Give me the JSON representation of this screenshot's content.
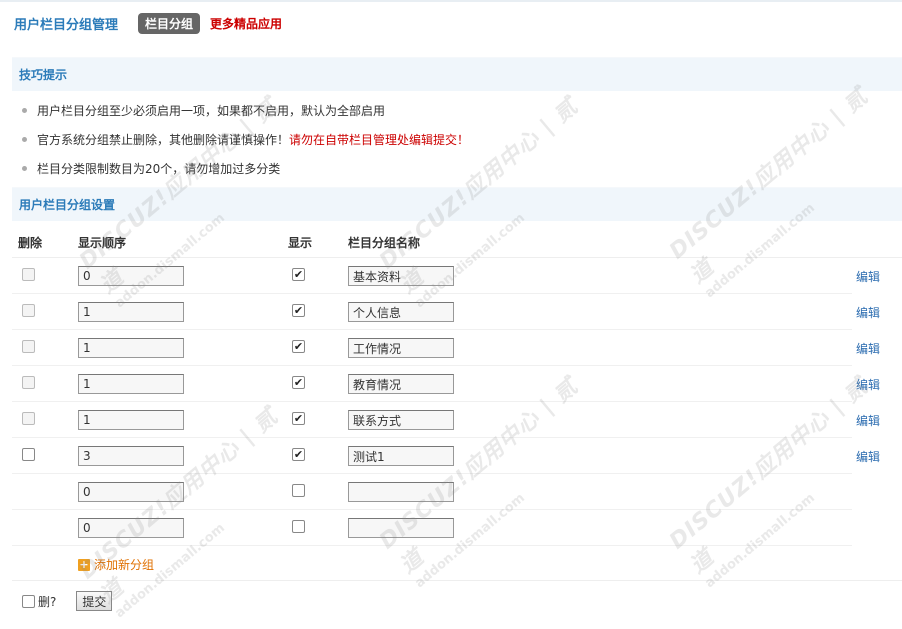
{
  "header": {
    "title": "用户栏目分组管理",
    "active_tab": "栏目分组",
    "more_link": "更多精品应用"
  },
  "tips": {
    "heading": "技巧提示",
    "items": [
      {
        "text": "用户栏目分组至少必须启用一项，如果都不启用，默认为全部启用",
        "warn": ""
      },
      {
        "text": "官方系统分组禁止删除，其他删除请谨慎操作！",
        "warn": "请勿在自带栏目管理处编辑提交！"
      },
      {
        "text": "栏目分类限制数目为20个，请勿增加过多分类",
        "warn": ""
      }
    ]
  },
  "settings": {
    "heading": "用户栏目分组设置",
    "columns": {
      "delete": "删除",
      "order": "显示顺序",
      "show": "显示",
      "name": "栏目分组名称"
    },
    "rows": [
      {
        "delete_enabled": false,
        "order": "0",
        "show": true,
        "name": "基本资料",
        "edit": "编辑"
      },
      {
        "delete_enabled": false,
        "order": "1",
        "show": true,
        "name": "个人信息",
        "edit": "编辑"
      },
      {
        "delete_enabled": false,
        "order": "1",
        "show": true,
        "name": "工作情况",
        "edit": "编辑"
      },
      {
        "delete_enabled": false,
        "order": "1",
        "show": true,
        "name": "教育情况",
        "edit": "编辑"
      },
      {
        "delete_enabled": false,
        "order": "1",
        "show": true,
        "name": "联系方式",
        "edit": "编辑"
      },
      {
        "delete_enabled": true,
        "order": "3",
        "show": true,
        "name": "测试1",
        "edit": "编辑"
      },
      {
        "delete_enabled": null,
        "order": "0",
        "show": false,
        "name": "",
        "edit": ""
      },
      {
        "delete_enabled": null,
        "order": "0",
        "show": false,
        "name": "",
        "edit": ""
      }
    ],
    "add_label": "添加新分组"
  },
  "footer": {
    "delete_label": "删?",
    "submit_label": "提交"
  },
  "watermark": {
    "main": "DISCUZ!应用中心 | 贰道",
    "sub": "addon.dismall.com"
  }
}
